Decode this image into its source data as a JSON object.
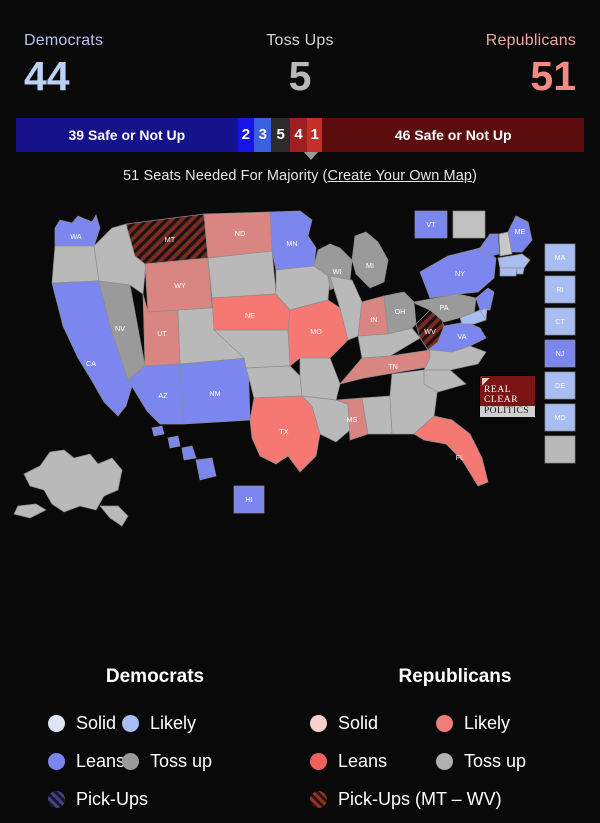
{
  "scoreboard": {
    "dem_label": "Democrats",
    "dem_count": "44",
    "toss_label": "Toss Ups",
    "toss_count": "5",
    "rep_label": "Republicans",
    "rep_count": "51"
  },
  "bar": {
    "dem_safe": "39 Safe or Not Up",
    "d2": "2",
    "d3": "3",
    "toss": "5",
    "r4": "4",
    "r1": "1",
    "rep_safe": "46 Safe or Not Up"
  },
  "majority": {
    "text_before": "51 Seats Needed For Majority (",
    "link": "Create Your Own Map",
    "text_after": ")"
  },
  "colors": {
    "dem_solid": "#dfe4f7",
    "dem_likely": "#a8bdf0",
    "dem_leans": "#7b86ee",
    "rep_solid": "#f9cfcc",
    "rep_likely": "#d98582",
    "rep_leans": "#f57872",
    "tossup": "#b9b9b9",
    "tossup_dark": "#9a9a9a",
    "dem_pickup": "#4b4f9e",
    "rep_pickup": "#7d2a22",
    "bar_dem_safe": "#15128c",
    "bar_rep_safe": "#5c0d0d",
    "background": "#090909"
  },
  "logo": {
    "line1": "REAL",
    "line2": "CLEAR",
    "line3": "POLITICS"
  },
  "legend": {
    "dem_heading": "Democrats",
    "rep_heading": "Republicans",
    "dem_items": [
      {
        "label": "Solid",
        "color": "#dfe4f7",
        "pattern": false
      },
      {
        "label": "Likely",
        "color": "#a8bdf0",
        "pattern": false
      },
      {
        "label": "Leans",
        "color": "#7b86ee",
        "pattern": false
      },
      {
        "label": "Toss up",
        "color": "#9a9a9a",
        "pattern": false
      },
      {
        "label": "Pick-Ups",
        "color": "#3f4480",
        "pattern": true
      }
    ],
    "rep_items": [
      {
        "label": "Solid",
        "color": "#f9cfcc",
        "pattern": false
      },
      {
        "label": "Likely",
        "color": "#ef7d78",
        "pattern": false
      },
      {
        "label": "Leans",
        "color": "#f0615c",
        "pattern": false
      },
      {
        "label": "Toss up",
        "color": "#b0b0b0",
        "pattern": false
      },
      {
        "label": "Pick-Ups (MT – WV)",
        "color": "#7d2a22",
        "pattern": true
      }
    ]
  },
  "map": {
    "states": [
      {
        "code": "WA",
        "rating": "dem_leans",
        "label": "WA"
      },
      {
        "code": "OR",
        "rating": "tossup",
        "label": ""
      },
      {
        "code": "CA",
        "rating": "dem_leans",
        "label": "CA"
      },
      {
        "code": "NV",
        "rating": "tossup_dark",
        "label": "NV"
      },
      {
        "code": "ID",
        "rating": "tossup",
        "label": ""
      },
      {
        "code": "MT",
        "rating": "rep_pickup",
        "label": "MT"
      },
      {
        "code": "WY",
        "rating": "rep_likely",
        "label": "WY"
      },
      {
        "code": "UT",
        "rating": "rep_likely",
        "label": "UT"
      },
      {
        "code": "AZ",
        "rating": "dem_leans",
        "label": "AZ"
      },
      {
        "code": "NM",
        "rating": "dem_leans",
        "label": "NM"
      },
      {
        "code": "CO",
        "rating": "tossup",
        "label": ""
      },
      {
        "code": "ND",
        "rating": "rep_likely",
        "label": "ND"
      },
      {
        "code": "SD",
        "rating": "tossup",
        "label": ""
      },
      {
        "code": "NE",
        "rating": "rep_leans",
        "label": "NE"
      },
      {
        "code": "KS",
        "rating": "tossup",
        "label": ""
      },
      {
        "code": "OK",
        "rating": "tossup",
        "label": ""
      },
      {
        "code": "TX",
        "rating": "rep_leans",
        "label": "TX"
      },
      {
        "code": "MN",
        "rating": "dem_leans",
        "label": "MN"
      },
      {
        "code": "IA",
        "rating": "tossup",
        "label": ""
      },
      {
        "code": "MO",
        "rating": "rep_leans",
        "label": "MO"
      },
      {
        "code": "AR",
        "rating": "tossup",
        "label": ""
      },
      {
        "code": "LA",
        "rating": "tossup",
        "label": ""
      },
      {
        "code": "WI",
        "rating": "tossup_dark",
        "label": "WI"
      },
      {
        "code": "IL",
        "rating": "tossup",
        "label": ""
      },
      {
        "code": "MS",
        "rating": "rep_likely",
        "label": "MS"
      },
      {
        "code": "AL",
        "rating": "tossup",
        "label": ""
      },
      {
        "code": "MI",
        "rating": "tossup_dark",
        "label": "MI"
      },
      {
        "code": "IN",
        "rating": "rep_likely",
        "label": "IN"
      },
      {
        "code": "KY",
        "rating": "tossup",
        "label": ""
      },
      {
        "code": "TN",
        "rating": "rep_likely",
        "label": "TN"
      },
      {
        "code": "GA",
        "rating": "tossup",
        "label": ""
      },
      {
        "code": "FL",
        "rating": "rep_leans",
        "label": "FL"
      },
      {
        "code": "OH",
        "rating": "tossup_dark",
        "label": "OH"
      },
      {
        "code": "WV",
        "rating": "rep_pickup",
        "label": "WV"
      },
      {
        "code": "VA",
        "rating": "dem_leans",
        "label": "VA"
      },
      {
        "code": "NC",
        "rating": "tossup",
        "label": ""
      },
      {
        "code": "SC",
        "rating": "tossup",
        "label": ""
      },
      {
        "code": "PA",
        "rating": "tossup_dark",
        "label": "PA"
      },
      {
        "code": "NY",
        "rating": "dem_leans",
        "label": "NY"
      },
      {
        "code": "ME",
        "rating": "dem_leans",
        "label": "ME"
      },
      {
        "code": "NH",
        "rating": "tossup",
        "label": ""
      },
      {
        "code": "MA",
        "rating": "dem_likely",
        "label": "MA"
      },
      {
        "code": "AK",
        "rating": "tossup",
        "label": ""
      },
      {
        "code": "HI",
        "rating": "dem_leans",
        "label": ""
      }
    ],
    "boxes_top": [
      {
        "code": "VT",
        "rating": "dem_leans",
        "label": "VT"
      },
      {
        "code": "NH",
        "rating": "tossup",
        "label": ""
      }
    ],
    "boxes_right": [
      {
        "code": "MA",
        "rating": "dem_likely",
        "label": "MA"
      },
      {
        "code": "RI",
        "rating": "dem_likely",
        "label": "RI"
      },
      {
        "code": "CT",
        "rating": "dem_likely",
        "label": "CT"
      },
      {
        "code": "NJ",
        "rating": "dem_leans",
        "label": "NJ"
      },
      {
        "code": "DE",
        "rating": "dem_likely",
        "label": "DE"
      },
      {
        "code": "MD",
        "rating": "dem_likely",
        "label": "MD"
      },
      {
        "code": "NA",
        "rating": "tossup",
        "label": ""
      }
    ],
    "boxes_other": [
      {
        "code": "HI",
        "rating": "dem_leans",
        "label": "HI"
      }
    ]
  }
}
